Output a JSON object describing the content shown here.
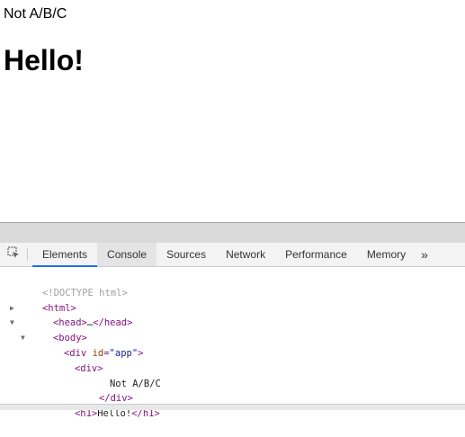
{
  "page": {
    "text": "Not A/B/C",
    "heading": "Hello!"
  },
  "devtools": {
    "tabs": [
      {
        "label": "Elements",
        "active": true
      },
      {
        "label": "Console",
        "active": false
      },
      {
        "label": "Sources",
        "active": false
      },
      {
        "label": "Network",
        "active": false
      },
      {
        "label": "Performance",
        "active": false
      },
      {
        "label": "Memory",
        "active": false
      }
    ],
    "more_label": "»",
    "accent_color": "#1a73e8",
    "dom": {
      "doctype": "<!DOCTYPE html>",
      "html_open": "<html>",
      "head_open": "<head>",
      "head_ellipsis": "…",
      "head_close": "</head>",
      "body_open": "<body>",
      "div_app_open_start": "<div",
      "div_app_attr_name": "id",
      "div_app_attr_val": "\"app\"",
      "div_app_open_end": ">",
      "div_inner_open": "<div>",
      "div_inner_text": "Not A/B/C",
      "div_inner_close": "</div>",
      "h1_open": "<h1>",
      "h1_text": "Hello!",
      "h1_close": "</h1>"
    }
  }
}
